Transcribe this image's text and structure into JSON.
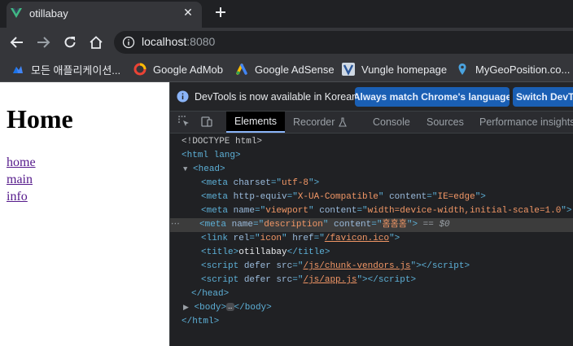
{
  "browser": {
    "tab": {
      "title": "otillabay",
      "close_glyph": "✕",
      "favicon": "vue-logo-icon"
    },
    "new_tab_glyph": "+",
    "omnibox": {
      "host": "localhost",
      "port": ":8080"
    },
    "bookmarks": [
      {
        "label": "모든 애플리케이션...",
        "icon": "apps-icon"
      },
      {
        "label": "Google AdMob",
        "icon": "admob-icon"
      },
      {
        "label": "Google AdSense",
        "icon": "adsense-icon"
      },
      {
        "label": "Vungle homepage",
        "icon": "vungle-icon"
      },
      {
        "label": "MyGeoPosition.co...",
        "icon": "location-pin-icon"
      }
    ]
  },
  "page": {
    "title": "Home",
    "links": [
      "home",
      "main",
      "info"
    ]
  },
  "devtools": {
    "infobar": {
      "message": "DevTools is now available in Korean!",
      "primary_button": "Always match Chrome's language",
      "secondary_button": "Switch DevTo"
    },
    "tabs": [
      "Elements",
      "Recorder",
      "Console",
      "Sources",
      "Performance insights"
    ],
    "active_tab": "Elements",
    "dom": {
      "doctype": "<!DOCTYPE html>",
      "html_open": "<html lang>",
      "head_open": "<head>",
      "meta_charset": {
        "attr": "charset",
        "value": "utf-8"
      },
      "meta_compat": {
        "attr1": "http-equiv",
        "value1": "X-UA-Compatible",
        "attr2": "content",
        "value2": "IE=edge"
      },
      "meta_viewport": {
        "attr1": "name",
        "value1": "viewport",
        "attr2": "content",
        "value2": "width=device-width,initial-scale=1.0"
      },
      "meta_description": {
        "attr1": "name",
        "value1": "description",
        "attr2": "content",
        "value2": "홈홈홈",
        "marker": "== $0"
      },
      "link_icon": {
        "attr1": "rel",
        "value1": "icon",
        "attr2": "href",
        "value2": "/favicon.ico"
      },
      "title_text": "otillabay",
      "script1_src": "/js/chunk-vendors.js",
      "script2_src": "/js/app.js",
      "head_close": "</head>",
      "body_open": "<body>",
      "body_close": "</body>",
      "html_close": "</html>",
      "ellipsis": "…",
      "row_dots": "⋯"
    }
  },
  "colors": {
    "accent": "#8ab4f8",
    "button_blue": "#1a5fb4",
    "link_visited": "#551a8b"
  }
}
